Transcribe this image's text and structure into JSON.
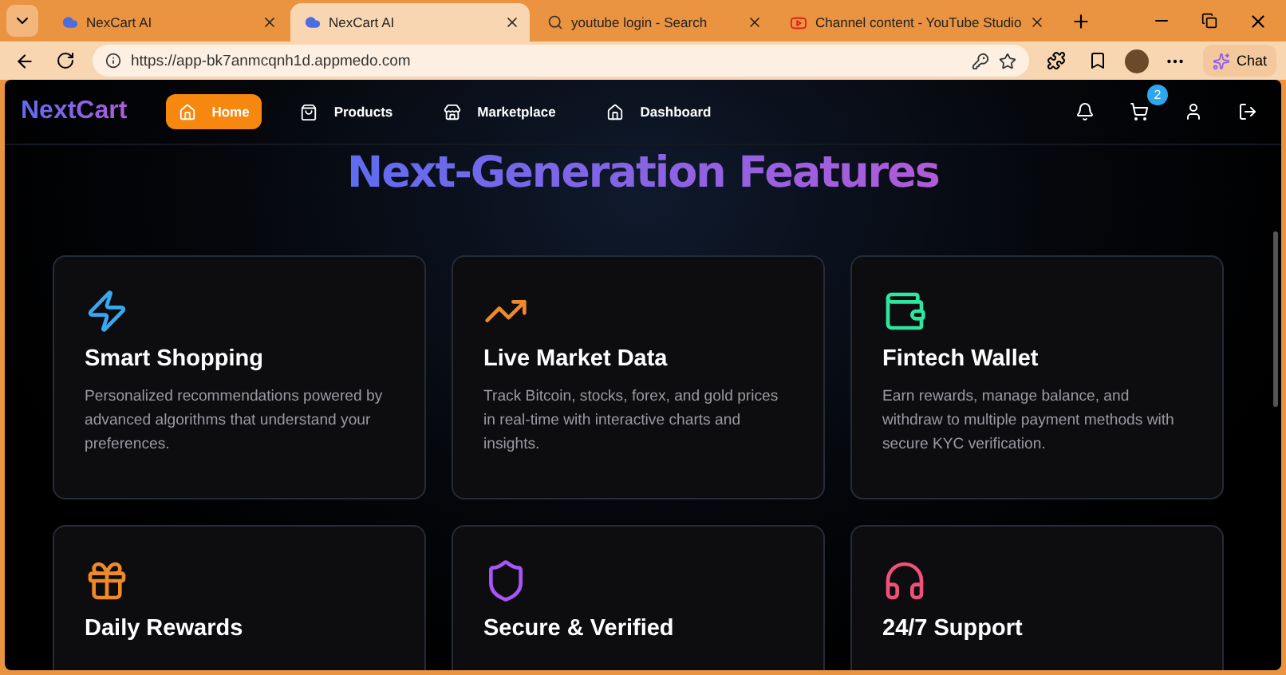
{
  "browser_tabs": [
    {
      "title": "NexCart AI",
      "kind": "app",
      "selected": false
    },
    {
      "title": "NexCart AI",
      "kind": "app",
      "selected": true
    },
    {
      "title": "youtube login - Search",
      "kind": "search",
      "selected": false
    },
    {
      "title": "Channel content - YouTube Studio",
      "kind": "video",
      "selected": false
    }
  ],
  "address_bar": {
    "url": "https://app-bk7anmcqnh1d.appmedo.com"
  },
  "chat_button": "Chat",
  "navbar": {
    "logo": "NextCart",
    "items": [
      {
        "label": "Home",
        "kind": "home",
        "selected": true
      },
      {
        "label": "Products",
        "kind": "bag",
        "selected": false
      },
      {
        "label": "Marketplace",
        "kind": "store",
        "selected": false
      },
      {
        "label": "Dashboard",
        "kind": "home",
        "selected": false
      }
    ],
    "cart_badge": "2"
  },
  "heading": "Next-Generation Features",
  "features": [
    {
      "title": "Smart Shopping",
      "description": "Personalized recommendations powered by advanced algorithms that understand your preferences.",
      "kind": "zap",
      "color": "#38a8f0"
    },
    {
      "title": "Live Market Data",
      "description": "Track Bitcoin, stocks, forex, and gold prices in real-time with interactive charts and insights.",
      "kind": "trend",
      "color": "#f0892a"
    },
    {
      "title": "Fintech Wallet",
      "description": "Earn rewards, manage balance, and withdraw to multiple payment methods with secure KYC verification.",
      "kind": "wallet",
      "color": "#2ee6a0"
    },
    {
      "title": "Daily Rewards",
      "kind": "gift",
      "color": "#f0892a"
    },
    {
      "title": "Secure & Verified",
      "kind": "shield",
      "color": "#a855f7"
    },
    {
      "title": "24/7 Support",
      "kind": "headphones",
      "color": "#f0507a"
    }
  ]
}
